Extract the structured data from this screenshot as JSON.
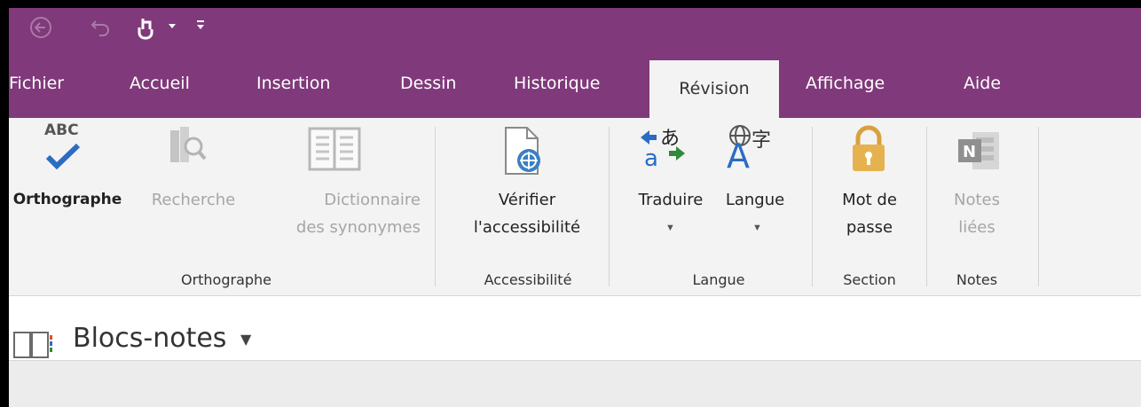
{
  "qat": {
    "icons": [
      "back-icon",
      "undo-icon",
      "touch-mode-icon",
      "qat-dropdown-icon",
      "customize-qat-icon"
    ]
  },
  "tabs": [
    {
      "label": "Fichier"
    },
    {
      "label": "Accueil"
    },
    {
      "label": "Insertion"
    },
    {
      "label": "Dessin"
    },
    {
      "label": "Historique"
    },
    {
      "label": "Révision",
      "active": true
    },
    {
      "label": "Affichage"
    },
    {
      "label": "Aide"
    }
  ],
  "ribbon": {
    "orthographe_btn": "Orthographe",
    "orthographe_icon_text": "ABC",
    "recherche_btn": "Recherche",
    "dictionnaire_line1": "Dictionnaire",
    "dictionnaire_line2": "des synonymes",
    "verifier_line1": "Vérifier",
    "verifier_line2": "l'accessibilité",
    "traduire_btn": "Traduire",
    "langue_btn": "Langue",
    "motdepasse_line1": "Mot de",
    "motdepasse_line2": "passe",
    "notes_line1": "Notes",
    "notes_line2": "liées",
    "groups": {
      "orthographe": "Orthographe",
      "accessibilite": "Accessibilité",
      "langue": "Langue",
      "section": "Section",
      "notes": "Notes"
    }
  },
  "notebook": {
    "title": "Blocs-notes"
  },
  "colors": {
    "titlebar": "#80397b",
    "ribbon_bg": "#f3f3f3",
    "check_blue": "#2b6cc4",
    "lock_gold": "#e6b24f"
  }
}
